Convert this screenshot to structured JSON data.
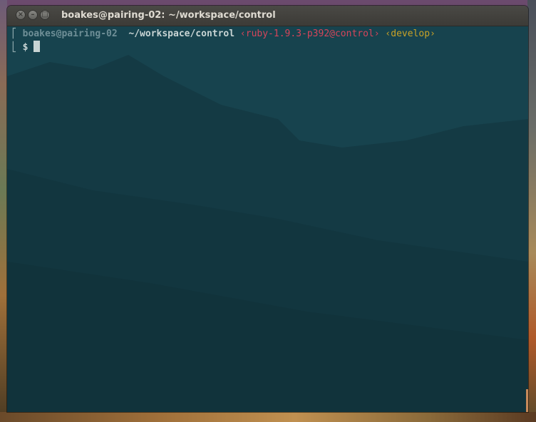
{
  "window": {
    "title": "boakes@pairing-02: ~/workspace/control",
    "buttons": {
      "close_icon": "close-icon",
      "minimize_icon": "minimize-icon",
      "maximize_icon": "maximize-icon"
    }
  },
  "terminal": {
    "prompt_line": {
      "bracket_top": "⎡",
      "user_host": "boakes@pairing-02",
      "cwd": "~/workspace/control",
      "ruby": "‹ruby-1.9.3-p392@control›",
      "branch": "‹develop›"
    },
    "input_line": {
      "bracket_bottom": "⎣",
      "prompt_symbol": "$"
    }
  },
  "colors": {
    "terminal_bg": "#17434e",
    "ruby": "#d6455a",
    "branch": "#c9a227",
    "user_host": "#6f8f97",
    "cwd": "#c8d4d4"
  }
}
